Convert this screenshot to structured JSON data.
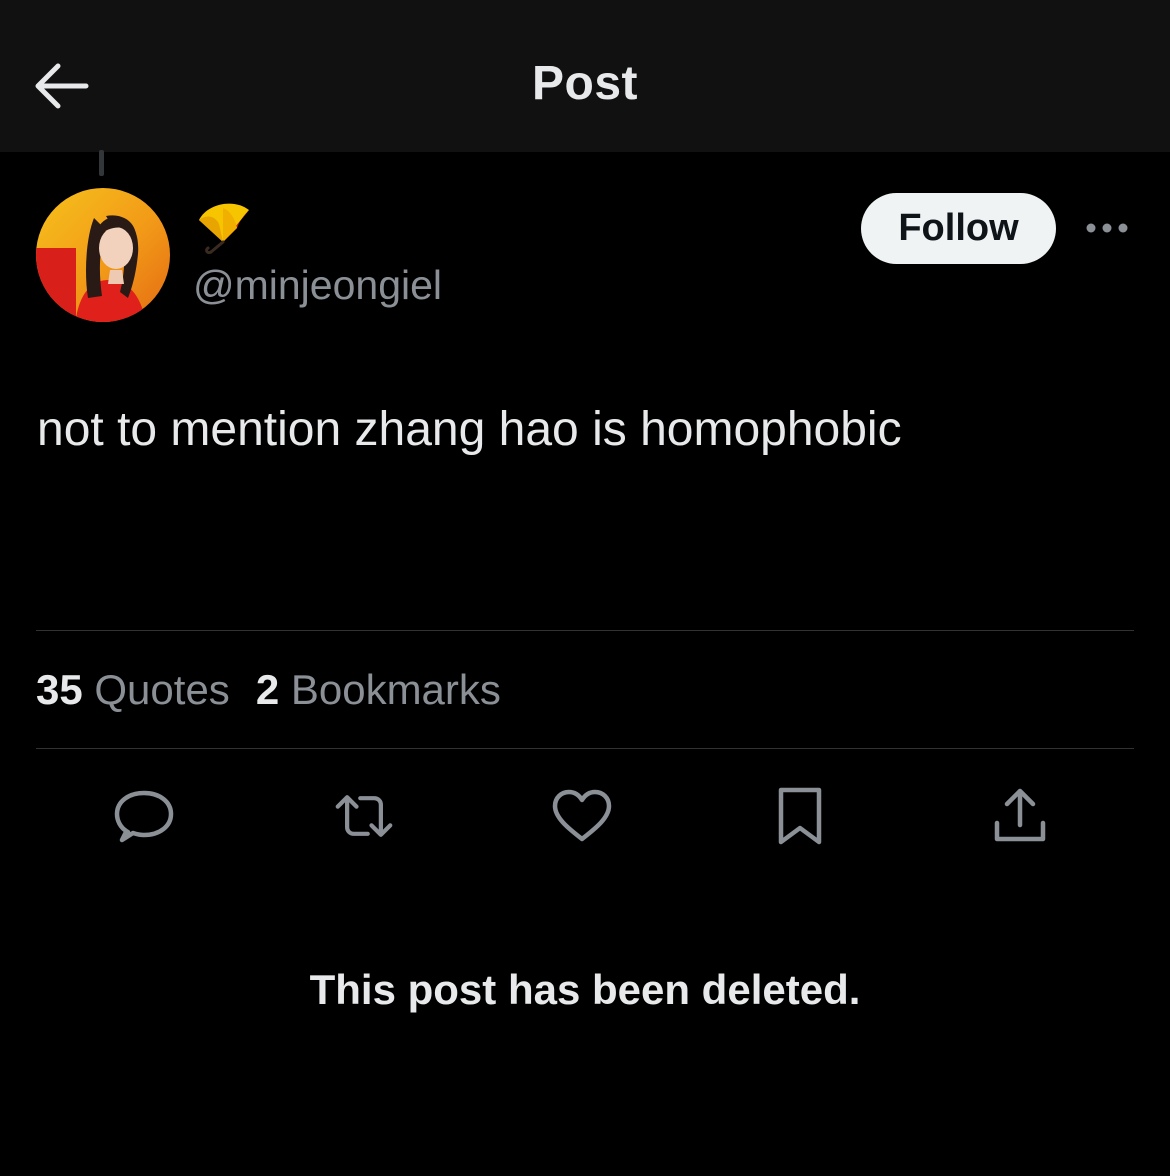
{
  "header": {
    "title": "Post",
    "back_icon": "arrow-left-icon"
  },
  "author": {
    "display_name_emoji": "umbrella-emoji",
    "handle": "@minjeongiel",
    "avatar": "avatar-photo"
  },
  "follow": {
    "label": "Follow"
  },
  "post": {
    "text": "not to mention zhang hao is homophobic"
  },
  "stats": {
    "quotes_count": "35",
    "quotes_label": "Quotes",
    "bookmarks_count": "2",
    "bookmarks_label": "Bookmarks"
  },
  "actions": [
    "reply-icon",
    "repost-icon",
    "like-icon",
    "bookmark-icon",
    "share-icon"
  ],
  "notice": {
    "text": "This post has been deleted."
  },
  "colors": {
    "background": "#000000",
    "header_bg": "#111111",
    "text_primary": "#e7e9ea",
    "text_secondary": "#8b9096",
    "divider": "#2f3336",
    "follow_bg": "#eff3f4"
  }
}
